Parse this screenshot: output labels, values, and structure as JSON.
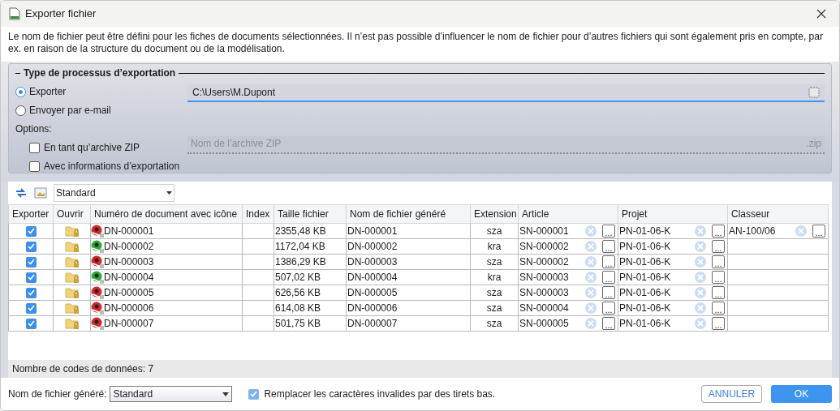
{
  "window": {
    "title": "Exporter fichier"
  },
  "description": "Le nom de fichier peut être défini pour les fiches de documents sélectionnées. Il n’est pas possible d’influencer le nom de fichier pour d’autres fichiers qui sont également pris en compte, par ex. en raison de la structure du document ou de la modélisation.",
  "export_type": {
    "legend": "Type de processus d’exportation",
    "modes": [
      {
        "label": "Exporter",
        "selected": true
      },
      {
        "label": "Envoyer par e-mail",
        "selected": false
      }
    ],
    "path": {
      "value": "C:\\Users\\M.Dupont"
    },
    "options_label": "Options:",
    "options": [
      {
        "label": "En tant qu’archive ZIP",
        "checked": false
      },
      {
        "label": "Avec informations d’exportation",
        "checked": false
      }
    ],
    "zip_name": {
      "placeholder": "Nom de l’archive ZIP",
      "suffix": ".zip"
    }
  },
  "toolbar": {
    "view": "Standard"
  },
  "table": {
    "browse_button": "...",
    "columns": [
      "Exporter",
      "Ouvrir",
      "Numéro de document avec icône",
      "Index",
      "Taille fichier",
      "Nom de fichier généré",
      "Extension",
      "Article",
      "Projet",
      "Classeur"
    ],
    "rows": [
      {
        "export": true,
        "color": "#d62828",
        "document": "DN-000001",
        "size": "2355,48 KB",
        "filename": "DN-000001",
        "extension": "sza",
        "article": "SN-000001",
        "projet": "PN-01-06-K",
        "classeur": "AN-100/06"
      },
      {
        "export": true,
        "color": "#2eaa3a",
        "document": "DN-000002",
        "size": "1172,04 KB",
        "filename": "DN-000002",
        "extension": "kra",
        "article": "SN-000002",
        "projet": "PN-01-06-K"
      },
      {
        "export": true,
        "color": "#d62828",
        "document": "DN-000003",
        "size": "1386,29 KB",
        "filename": "DN-000003",
        "extension": "sza",
        "article": "SN-000002",
        "projet": "PN-01-06-K"
      },
      {
        "export": true,
        "color": "#2eaa3a",
        "document": "DN-000004",
        "size": "507,02 KB",
        "filename": "DN-000004",
        "extension": "kra",
        "article": "SN-000003",
        "projet": "PN-01-06-K"
      },
      {
        "export": true,
        "color": "#d62828",
        "document": "DN-000005",
        "size": "626,56 KB",
        "filename": "DN-000005",
        "extension": "sza",
        "article": "SN-000003",
        "projet": "PN-01-06-K"
      },
      {
        "export": true,
        "color": "#d62828",
        "document": "DN-000006",
        "size": "614,08 KB",
        "filename": "DN-000006",
        "extension": "sza",
        "article": "SN-000004",
        "projet": "PN-01-06-K"
      },
      {
        "export": true,
        "color": "#d62828",
        "document": "DN-000007",
        "size": "501,75 KB",
        "filename": "DN-000007",
        "extension": "sza",
        "article": "SN-000005",
        "projet": "PN-01-06-K"
      }
    ]
  },
  "status_bar": "Nombre de codes de données: 7",
  "footer": {
    "filename_label": "Nom de fichier généré:",
    "filename_mode": "Standard",
    "replace": {
      "label": "Remplacer les caractères invalides par des tirets bas.",
      "checked": true
    },
    "buttons": [
      "ANNULER",
      "OK"
    ]
  }
}
